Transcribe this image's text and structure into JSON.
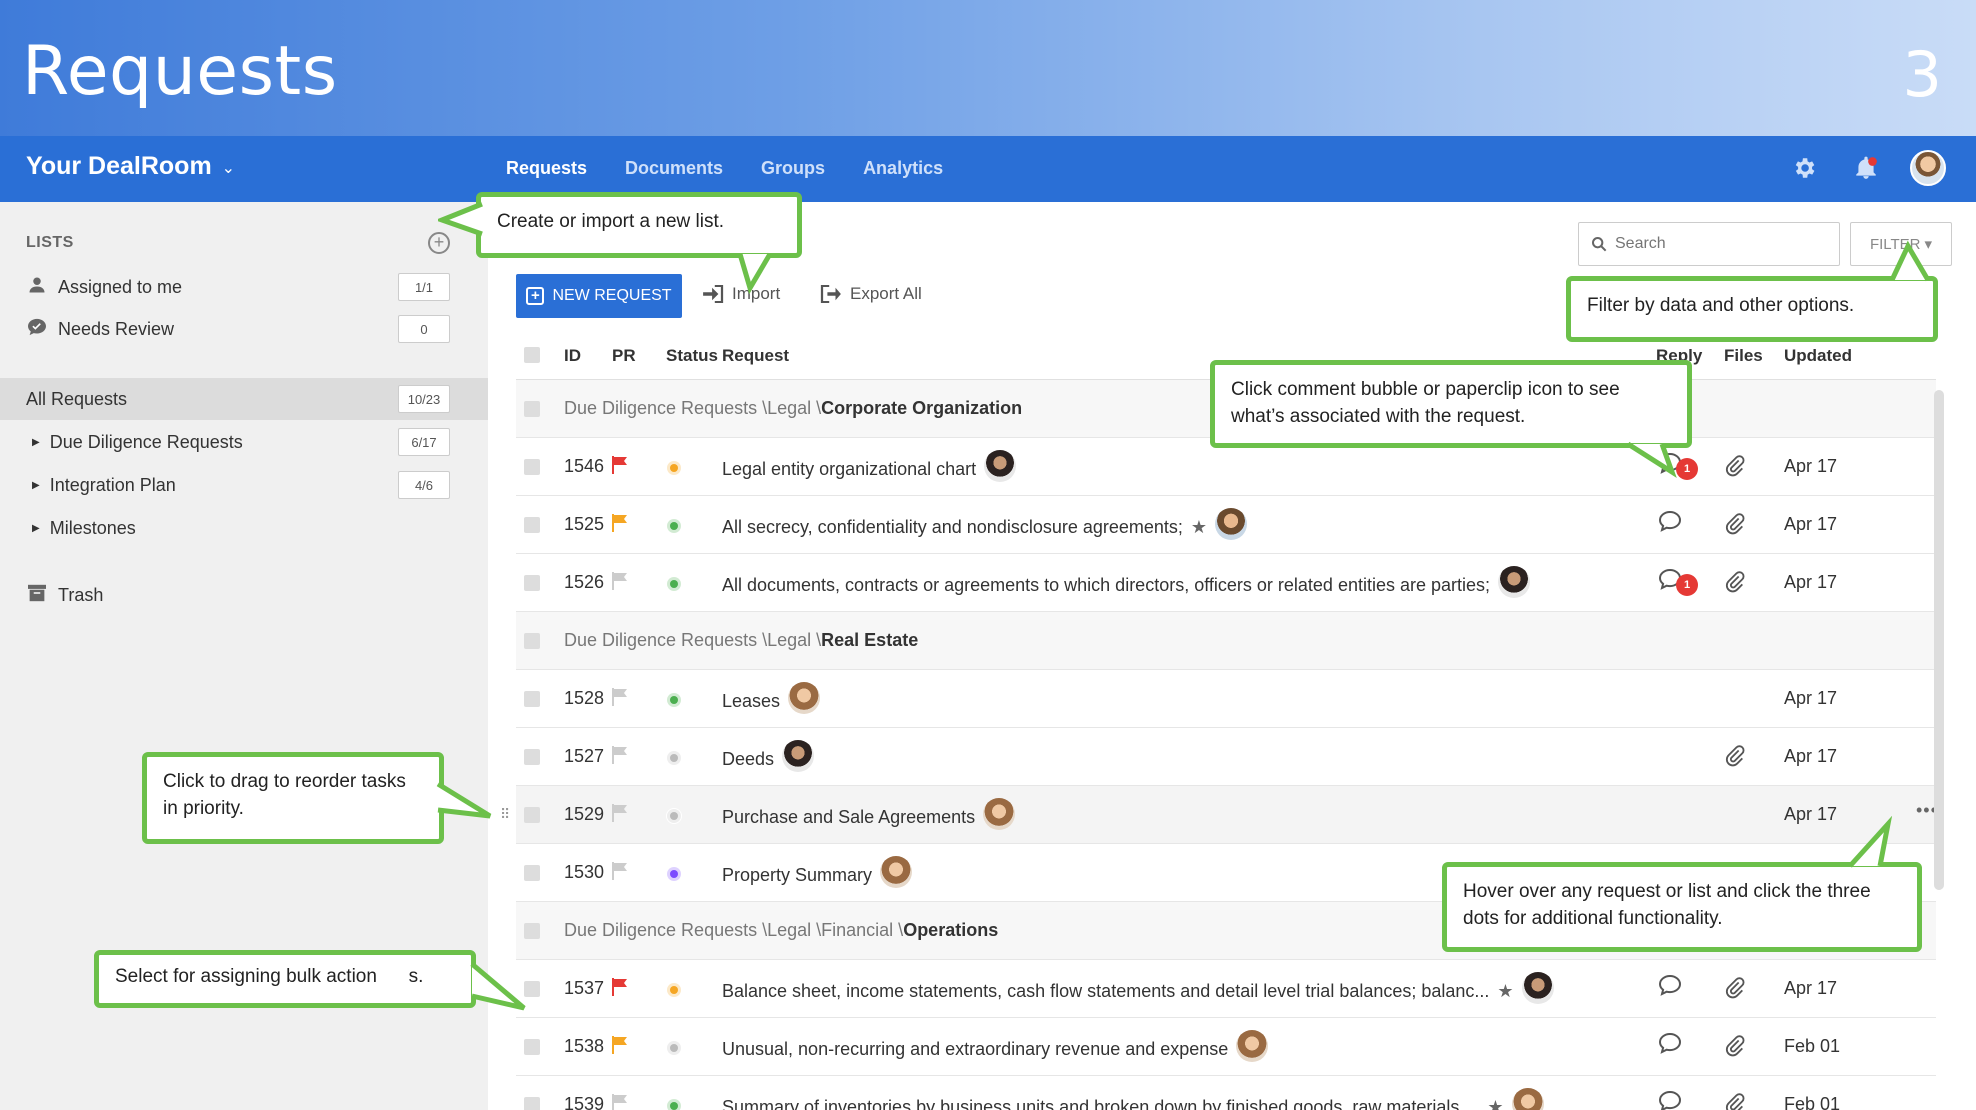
{
  "banner": {
    "title": "Requests",
    "page_number": "3"
  },
  "navbar": {
    "brand": "Your DealRoom",
    "tabs": [
      {
        "label": "Requests",
        "active": true
      },
      {
        "label": "Documents",
        "active": false
      },
      {
        "label": "Groups",
        "active": false
      },
      {
        "label": "Analytics",
        "active": false
      }
    ],
    "icons": [
      "gear-icon",
      "bell-icon",
      "user-avatar"
    ]
  },
  "sidebar": {
    "header": "LISTS",
    "items": [
      {
        "label": "Assigned to me",
        "count": "1/1",
        "icon": "user-icon"
      },
      {
        "label": "Needs Review",
        "count": "0",
        "icon": "comment-check-icon"
      },
      {
        "label": "All Requests",
        "count": "10/23",
        "selected": true
      },
      {
        "label": "Due Diligence Requests",
        "count": "6/17"
      },
      {
        "label": "Integration Plan",
        "count": "4/6"
      },
      {
        "label": "Milestones",
        "count": ""
      },
      {
        "label": "Trash",
        "count": "",
        "icon": "trash-icon"
      }
    ]
  },
  "toolbar": {
    "new_request": "NEW REQUEST",
    "import": "Import",
    "export_all": "Export All",
    "search_placeholder": "Search",
    "filter": "FILTER"
  },
  "table": {
    "headers": {
      "id": "ID",
      "pr": "PR",
      "status": "Status",
      "request": "Request",
      "reply": "Reply",
      "files": "Files",
      "updated": "Updated"
    },
    "groups": {
      "g1": {
        "path": "Due Diligence Requests \\Legal \\",
        "name": "Corporate Organization"
      },
      "g2": {
        "path": "Due Diligence Requests \\Legal \\",
        "name": "Real Estate"
      },
      "g3": {
        "path": "Due Diligence Requests \\Legal \\Financial \\",
        "name": "Operations"
      }
    },
    "rows": [
      {
        "id": "1546",
        "request": "Legal entity organizational chart",
        "updated": "Apr 17",
        "reply_badge": "1",
        "flag": "#e53935",
        "status": "#f5a623"
      },
      {
        "id": "1525",
        "request": "All secrecy, confidentiality and nondisclosure agreements;",
        "updated": "Apr 17",
        "flag": "#f5a623",
        "status": "#4caf50"
      },
      {
        "id": "1526",
        "request": "All documents, contracts or agreements to which directors, officers or related entities are parties;",
        "updated": "Apr 17",
        "reply_badge": "1",
        "flag": "#cccccc",
        "status": "#4caf50"
      },
      {
        "id": "1528",
        "request": "Leases",
        "updated": "Apr 17",
        "flag": "#cccccc",
        "status": "#4caf50"
      },
      {
        "id": "1527",
        "request": "Deeds",
        "updated": "Apr 17",
        "flag": "#cccccc",
        "status": "#bbbbbb"
      },
      {
        "id": "1529",
        "request": "Purchase and Sale Agreements",
        "updated": "Apr 17",
        "flag": "#cccccc",
        "status": "#bbbbbb"
      },
      {
        "id": "1530",
        "request": "Property Summary",
        "updated": "",
        "flag": "#cccccc",
        "status": "#7c4dff"
      },
      {
        "id": "1537",
        "request": "Balance sheet, income statements, cash flow statements and detail level trial balances; balanc...",
        "updated": "Apr 17",
        "flag": "#e53935",
        "status": "#f5a623"
      },
      {
        "id": "1538",
        "request": "Unusual, non-recurring and extraordinary revenue and expense",
        "updated": "Feb 01",
        "flag": "#f5a623",
        "status": "#bbbbbb"
      },
      {
        "id": "1539",
        "request": "Summary of inventories by business units and broken down by finished goods, raw materials,...",
        "updated": "Feb 01",
        "flag": "#cccccc",
        "status": "#4caf50"
      }
    ]
  },
  "callouts": {
    "new_list": "Create or import a new list.",
    "filter": "Filter by data and other options.",
    "comment": "Click comment bubble or paperclip icon to see what’s associated with the request.",
    "drag": "Click to drag to reorder tasks in priority.",
    "hover": "Hover over any request or list and click the three dots for additional functionality.",
    "bulk": "Select for assigning bulk action      s."
  },
  "colors": {
    "accent": "#2a6fd6",
    "callout_border": "#6cc04a"
  }
}
